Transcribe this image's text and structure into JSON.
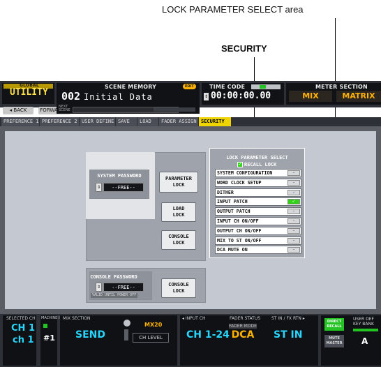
{
  "callouts": {
    "lock_area": "LOCK PARAMETER SELECT area",
    "security": "SECURITY"
  },
  "header": {
    "global_label": "GLOBAL",
    "utility": "UTILITY",
    "back": "◂ BACK",
    "forward": "FORWARD ▸",
    "scene_memory_label": "SCENE MEMORY",
    "edit_badge": "EDIT",
    "scene_number": "002",
    "scene_name": "Initial Data",
    "next_scene": "NEXT\nSCENE",
    "time_code_label": "TIME CODE",
    "time_code_value": "00:00:00.00",
    "meter_section_label": "METER SECTION",
    "meter_mix": "MIX",
    "meter_matrix": "MATRIX"
  },
  "tabs": [
    {
      "label": "PREFERENCE 1",
      "active": false
    },
    {
      "label": "PREFERENCE 2",
      "active": false
    },
    {
      "label": "USER DEFINE",
      "active": false
    },
    {
      "label": "SAVE",
      "active": false
    },
    {
      "label": "LOAD",
      "active": false
    },
    {
      "label": "FADER ASSIGN",
      "active": false
    },
    {
      "label": "SECURITY",
      "active": true
    }
  ],
  "security": {
    "system_password_label": "SYSTEM PASSWORD",
    "system_password_value": "--FREE--",
    "parameter_lock": "PARAMETER\nLOCK",
    "load_lock": "LOAD\nLOCK",
    "console_lock": "CONSOLE\nLOCK",
    "console_password_label": "CONSOLE PASSWORD",
    "console_password_value": "--FREE--",
    "console_lock_2": "CONSOLE\nLOCK",
    "valid_note": "VALID UNTIL POWER OFF",
    "lock_title": "LOCK PARAMETER SELECT",
    "recall_lock": "RECALL LOCK",
    "recall_lock_checked": true,
    "items": [
      {
        "label": "SYSTEM CONFIGURATION",
        "on": false
      },
      {
        "label": "WORD CLOCK SETUP",
        "on": false
      },
      {
        "label": "DITHER",
        "on": false
      },
      {
        "label": "INPUT PATCH",
        "on": true
      },
      {
        "label": "OUTPUT PATCH",
        "on": false
      },
      {
        "label": "INPUT CH ON/OFF",
        "on": false
      },
      {
        "label": "OUTPUT CH ON/OFF",
        "on": false
      },
      {
        "label": "MIX TO ST ON/OFF",
        "on": false
      },
      {
        "label": "DCA MUTE ON",
        "on": false
      }
    ],
    "toggle_off": "–",
    "toggle_on": "✓"
  },
  "status": {
    "selected_ch_label": "SELECTED CH",
    "ch_line1": "CH 1",
    "ch_line2": "ch 1",
    "machine_id_label": "MACHINE ID",
    "machine_id": "#1",
    "mix_section_label": "MIX SECTION",
    "mix_send": "SEND",
    "mix_bus": "MX20",
    "ch_level": "CH LEVEL",
    "input_ch_label": "◂ INPUT CH",
    "input_ch_value": "CH 1-24",
    "fader_status_label": "FADER STATUS",
    "fader_mode": "FADER MODE",
    "fader_mode_value": "DCA",
    "st_in_label": "ST IN / FX RTN ▸",
    "st_in_value": "ST IN",
    "direct_recall": "DIRECT\nRECALL",
    "mute_master": "MUTE\nMASTER",
    "user_def_label": "USER DEF\nKEY BANK",
    "bank_value": "A"
  },
  "colors": {
    "accent_yellow": "#efd400",
    "toggle_on": "#33d11a",
    "amber": "#ffb200",
    "cyan": "#27d7ff"
  }
}
